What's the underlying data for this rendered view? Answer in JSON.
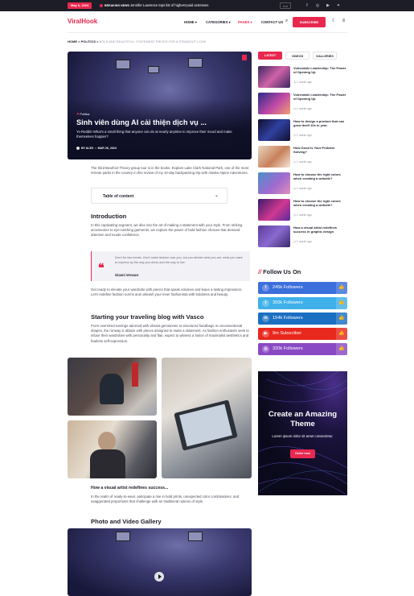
{
  "topbar": {
    "date": "May 6, 2024",
    "breaking_label": "BREAKING NEWS",
    "ticker": "Jennifer Lawrence tops list of highest-paid actresses",
    "arrows": "< >",
    "social_icons": [
      "facebook-icon",
      "instagram-icon",
      "youtube-icon",
      "twitter-icon"
    ]
  },
  "header": {
    "logo": "ViralHook",
    "nav": [
      "HOME",
      "CATEGORIES",
      "PAGES",
      "CONTACT US"
    ],
    "subscribe": "SUBSCRIBE"
  },
  "breadcrumb": {
    "home": "HOME",
    "section": "POLITICS",
    "current": "BOLD AND BEAUTIFUL: STATEMENT PIECES FOR A STANDOUT LOOK"
  },
  "hero": {
    "category": "Politics",
    "title": "Sinh viên dùng AI cải thiện dịch vụ ...",
    "excerpt": "Yo Reddit! What's a small thing that anyone can do at nearly anytime to improve their mood and make themselves happier?",
    "author": "BY ALEX",
    "date": "MAR 26, 2024"
  },
  "article": {
    "intro": "The third Bearfoot Theory group tour is in the books. Explore Lake Clark National Park, one of the most remote parks in the country in this review of my 10-day backpacking trip with Alaska Alpine Adventures.",
    "toc_label": "Table of content",
    "h_intro": "Introduction",
    "p_intro": "In this captivating segment, we dive into the art of making a statement with your style. From striking accessories to eye-catching garments, we explore the power of bold fashion choices that demand attention and exude confidence.",
    "quote_text": "Don't be into trends. Don't make fashion own you, but you decide what you are, what you want to express by the way you dress and the way to live.",
    "quote_author": "Gianni Versace",
    "p_after_quote": "Get ready to elevate your wardrobe with pieces that speak volumes and leave a lasting impression. Let's redefine fashion norms and unleash your inner fashionista with boldness and beauty.",
    "h_blog": "Starting your traveling blog with Vasco",
    "p_blog": "From oversized earrings adorned with vibrant gemstones to structured handbags in unconventional shapes, the runway is ablaze with pieces designed to make a statement. As fashion enthusiasts seek to infuse their wardrobes with personality and flair, expect to witness a fusion of maximalist aesthetics and fearless self-expression.",
    "h_visual": "How a visual artist redefines success...",
    "p_visual": "In the realm of ready-to-wear, anticipate a rise in bold prints, unexpected color combinations, and exaggerated proportions that challenge with an traditional notions of style.",
    "h_gallery": "Photo and Video Gallery"
  },
  "sidebar": {
    "tabs": [
      "LATEST",
      "VIDEOS",
      "GALLERIES"
    ],
    "items": [
      {
        "title": "Vulnerable Leadership: The Power of Opening Up",
        "date": "1 month ago"
      },
      {
        "title": "Vulnerable Leadership: The Power of Opening Up",
        "date": "1 month ago"
      },
      {
        "title": "How to design a product that can grow itself 10x in year.",
        "date": "1 month ago"
      },
      {
        "title": "How Good Is Your Problem Solving?",
        "date": "1 month ago"
      },
      {
        "title": "How to choose the right colors when creating a website?",
        "date": "1 month ago"
      },
      {
        "title": "How to choose the right colors when creating a website?",
        "date": "1 month ago"
      },
      {
        "title": "How a visual artist redefines success in graphic design",
        "date": "1 month ago"
      }
    ],
    "follow_title": "Follow Us On",
    "socials": [
      {
        "label": "245k Followers",
        "color": "#3b6fdc"
      },
      {
        "label": "300k Followers",
        "color": "#3fb0ea"
      },
      {
        "label": "154k Followers",
        "color": "#1b6fc2"
      },
      {
        "label": "9m Subscriber",
        "color": "#e8281e"
      },
      {
        "label": "320k Followers",
        "color": "#8a49c4"
      }
    ],
    "ad": {
      "title": "Create an Amazing Theme",
      "subtitle": "Lorem ipsum dolor sit amet consectetur.",
      "button": "Order now"
    }
  },
  "colors": {
    "accent": "#e8284f",
    "dark": "#1d1d28"
  }
}
